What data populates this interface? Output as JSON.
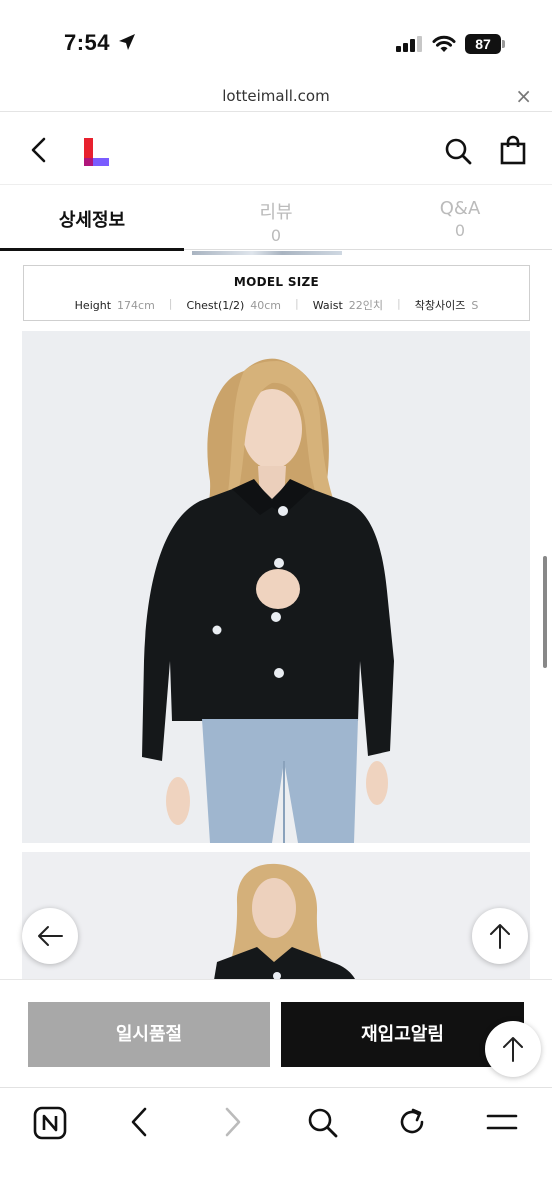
{
  "status_bar": {
    "time": "7:54",
    "battery": "87"
  },
  "url_bar": {
    "url": "lotteimall.com",
    "close": "×"
  },
  "tabs": [
    {
      "label": "상세정보",
      "count": ""
    },
    {
      "label": "리뷰",
      "count": "0"
    },
    {
      "label": "Q&A",
      "count": "0"
    }
  ],
  "model_size": {
    "title": "MODEL SIZE",
    "items": [
      {
        "label": "Height",
        "value": "174cm"
      },
      {
        "label": "Chest(1/2)",
        "value": "40cm"
      },
      {
        "label": "Waist",
        "value": "22인치"
      },
      {
        "label": "착창사이즈",
        "value": "S"
      }
    ]
  },
  "actions": {
    "soldout_label": "일시품절",
    "restock_label": "재입고알림"
  },
  "icons": [
    "back-icon",
    "lotte-logo",
    "search-icon",
    "shopping-bag-icon",
    "arrow-left-icon",
    "arrow-up-icon",
    "naver-icon",
    "forward-icon",
    "refresh-icon",
    "menu-icon"
  ],
  "colors": {
    "accent_red": "#e8212e",
    "accent_purple": "#7a5cff",
    "soldout_gray": "#a8a8a8",
    "primary_black": "#111111"
  }
}
